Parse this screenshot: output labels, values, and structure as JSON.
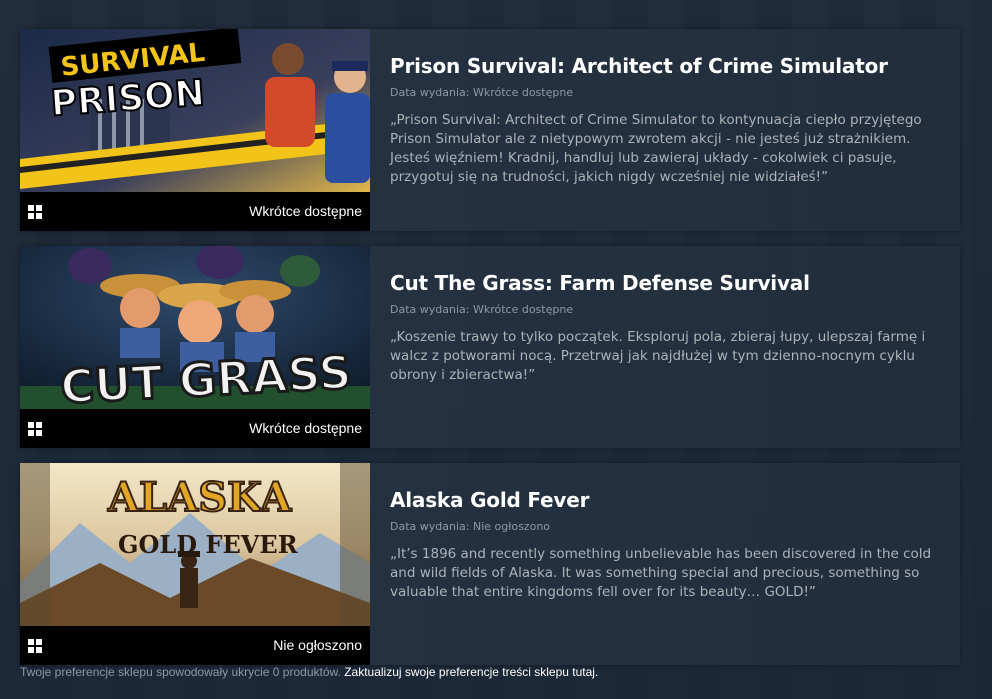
{
  "games": [
    {
      "title": "Prison Survival: Architect of Crime Simulator",
      "release_label": "Data wydania: Wkrótce dostępne",
      "description": "„Prison Survival: Architect of Crime Simulator to kontynuacja ciepło przyjętego Prison Simulator ale z nietypowym zwrotem akcji - nie jesteś już strażnikiem. Jesteś więźniem! Kradnij, handluj lub zawieraj układy - cokolwiek ci pasuje, przygotuj się na trudności, jakich nigdy wcześniej nie widziałeś!”",
      "capsule_status": "Wkrótce dostępne",
      "capsule_logo_line1": "SURVIVAL",
      "capsule_logo_line2": "PRISON",
      "platform_icon": "windows-icon"
    },
    {
      "title": "Cut The Grass: Farm Defense Survival",
      "release_label": "Data wydania: Wkrótce dostępne",
      "description": "„Koszenie trawy to tylko początek. Eksploruj pola, zbieraj łupy, ulepszaj farmę i walcz z potworami nocą. Przetrwaj jak najdłużej w tym dzienno-nocnym cyklu obrony i zbieractwa!”",
      "capsule_status": "Wkrótce dostępne",
      "capsule_logo_line1": "CUT GRASS",
      "platform_icon": "windows-icon"
    },
    {
      "title": "Alaska Gold Fever",
      "release_label": "Data wydania: Nie ogłoszono",
      "description": "„It’s 1896 and recently something unbelievable has been discovered in the cold and wild fields of Alaska. It was something special and precious, something so valuable that entire kingdoms fell over for its beauty… GOLD!”",
      "capsule_status": "Nie ogłoszono",
      "capsule_logo_line1": "ALASKA",
      "capsule_logo_line2": "GOLD FEVER",
      "platform_icon": "windows-icon"
    }
  ],
  "footer": {
    "text": "Twoje preferencje sklepu spowodowały ukrycie 0 produktów.",
    "link": "Zaktualizuj swoje preferencje treści sklepu tutaj."
  }
}
